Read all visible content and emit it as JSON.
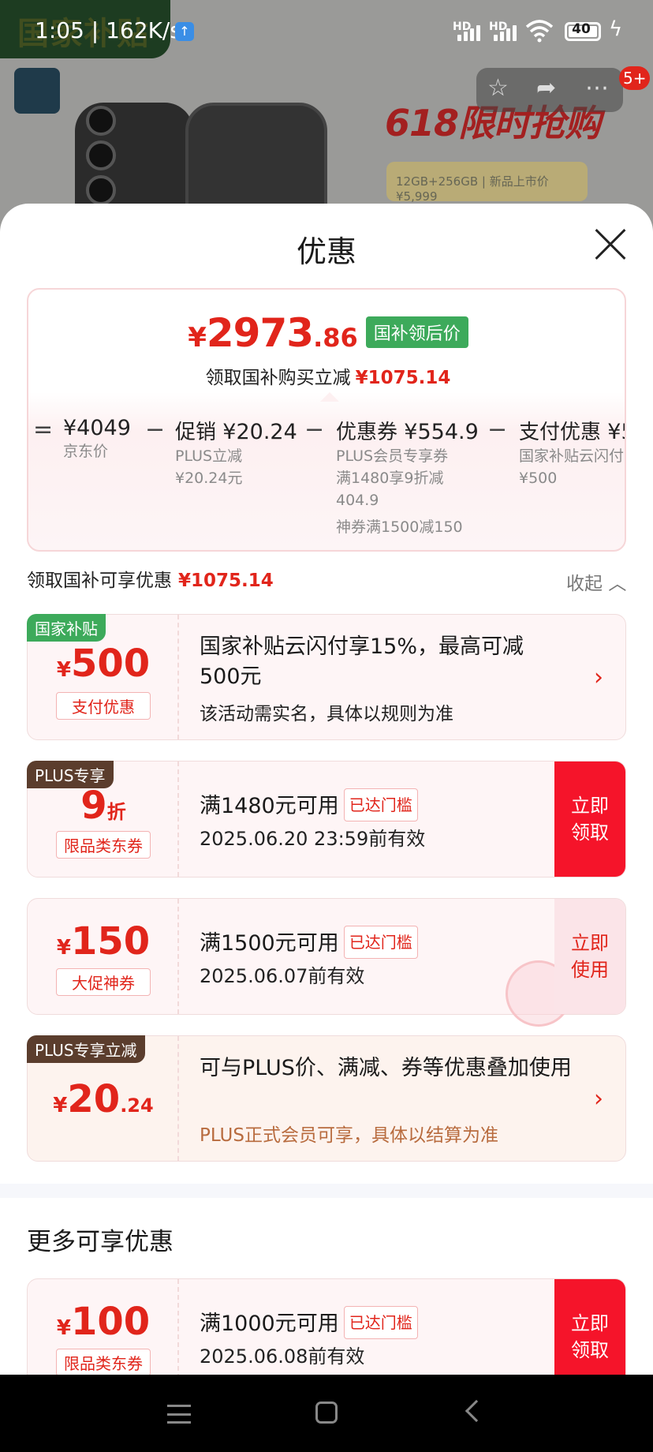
{
  "status_bar": {
    "time": "1:05",
    "speed": "162K/s",
    "signal1": "HD",
    "signal2": "HD",
    "battery": "40"
  },
  "background": {
    "tag": "国家补贴",
    "promo": "618限时抢购",
    "spec": "12GB+256GB | 新品上市价¥5,999",
    "badge": "5+"
  },
  "sheet": {
    "title": "优惠"
  },
  "summary": {
    "currency": "¥",
    "price_int": "2973",
    "price_dec": ".86",
    "price_tag": "国补领后价",
    "reduce_label": "领取国补购买立减",
    "reduce_amount": "¥1075.14",
    "items": [
      {
        "op": "=",
        "label": "",
        "value": "¥4049",
        "sub": [
          "京东价"
        ]
      },
      {
        "op": "−",
        "label": "促销",
        "value": "¥20.24",
        "sub": [
          "PLUS立减",
          "¥20.24元"
        ]
      },
      {
        "op": "−",
        "label": "优惠券",
        "value": "¥554.9",
        "sub": [
          "PLUS会员专享券",
          "满1480享9折减",
          "404.9",
          "神券满1500减150"
        ]
      },
      {
        "op": "−",
        "label": "支付优惠",
        "value": "¥5",
        "sub": [
          "国家补贴云闪付",
          "¥500"
        ]
      }
    ]
  },
  "section": {
    "label": "领取国补可享优惠",
    "amount": "¥1075.14",
    "collapse": "收起"
  },
  "coupons": [
    {
      "tag": "国家补贴",
      "currency": "¥",
      "amount": "500",
      "amount_small": "",
      "chip": "支付优惠",
      "title": "国家补贴云闪付享15%，最高可减500元",
      "desc": "该活动需实名，具体以规则为准",
      "action": ""
    },
    {
      "tag": "PLUS专享",
      "currency": "",
      "amount": "9",
      "amount_small": "折",
      "chip": "限品类东券",
      "title": "满1480元可用",
      "reached": "已达门槛",
      "meta": "2025.06.20 23:59前有效",
      "action": "立即领取"
    },
    {
      "tag": "",
      "currency": "¥",
      "amount": "150",
      "amount_small": "",
      "chip": "大促神券",
      "title": "满1500元可用",
      "reached": "已达门槛",
      "meta": "2025.06.07前有效",
      "action": "立即使用"
    },
    {
      "tag": "PLUS专享立减",
      "currency": "¥",
      "amount": "20",
      "amount_small": ".24",
      "chip": "",
      "title": "可与PLUS价、满减、券等优惠叠加使用",
      "desc": "PLUS正式会员可享，具体以结算为准",
      "action": ""
    }
  ],
  "more": {
    "title": "更多可享优惠",
    "coupon": {
      "currency": "¥",
      "amount": "100",
      "chip": "限品类东券",
      "title": "满1000元可用",
      "reached": "已达门槛",
      "meta": "2025.06.08前有效",
      "action": "立即领取"
    }
  },
  "colors": {
    "accent": "#e1251b",
    "green_tag": "#3daa5b",
    "action_red": "#f5142a",
    "plus_tag": "#5b3d2d"
  }
}
